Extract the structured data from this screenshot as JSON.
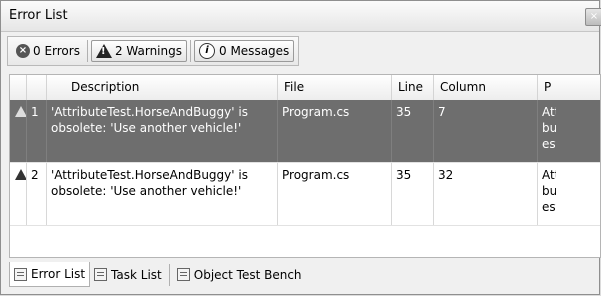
{
  "window": {
    "title": "Error List",
    "close_glyph": "×"
  },
  "toolbar": {
    "errors_label": "0 Errors",
    "warnings_label": "2 Warnings",
    "messages_label": "0 Messages",
    "errors_icon": "error-icon",
    "warnings_icon": "warning-icon",
    "messages_icon": "info-icon"
  },
  "table": {
    "columns": [
      "",
      "",
      "Description",
      "File",
      "Line",
      "Column",
      "P"
    ],
    "rows": [
      {
        "index": "1",
        "description": "'AttributeTest.HorseAndBuggy' is obsolete: 'Use another vehicle!'",
        "file": "Program.cs",
        "line": "35",
        "column": "7",
        "project": "Att bu est",
        "selected": true
      },
      {
        "index": "2",
        "description": "'AttributeTest.HorseAndBuggy' is obsolete: 'Use another vehicle!'",
        "file": "Program.cs",
        "line": "35",
        "column": "32",
        "project": "Att bu est",
        "selected": false
      }
    ]
  },
  "bottom_tabs": [
    "Error List",
    "Task List",
    "Object Test Bench"
  ],
  "colors": {
    "selected_row": "#6e6e6e",
    "panel_bg": "#f0f0f0"
  }
}
